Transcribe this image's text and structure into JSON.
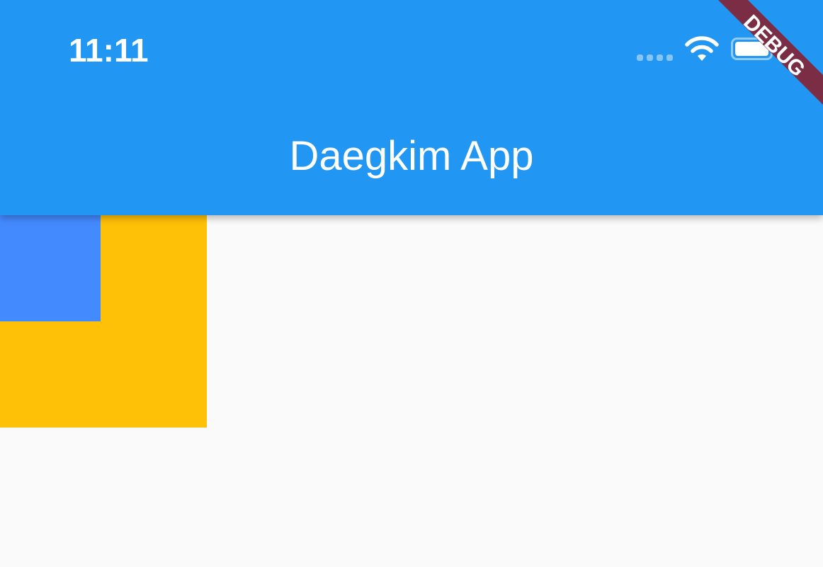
{
  "status_bar": {
    "time": "11:11",
    "signal_icon": "signal-dots-icon",
    "wifi_icon": "wifi-icon",
    "battery_icon": "battery-icon"
  },
  "app_bar": {
    "title": "Daegkim App",
    "color": "#2196f3"
  },
  "debug_banner": {
    "label": "DEBUG",
    "color": "#7b2d45"
  },
  "body": {
    "background": "#fafafa",
    "outer_box_color": "#ffc107",
    "inner_box_color": "#448aff"
  }
}
